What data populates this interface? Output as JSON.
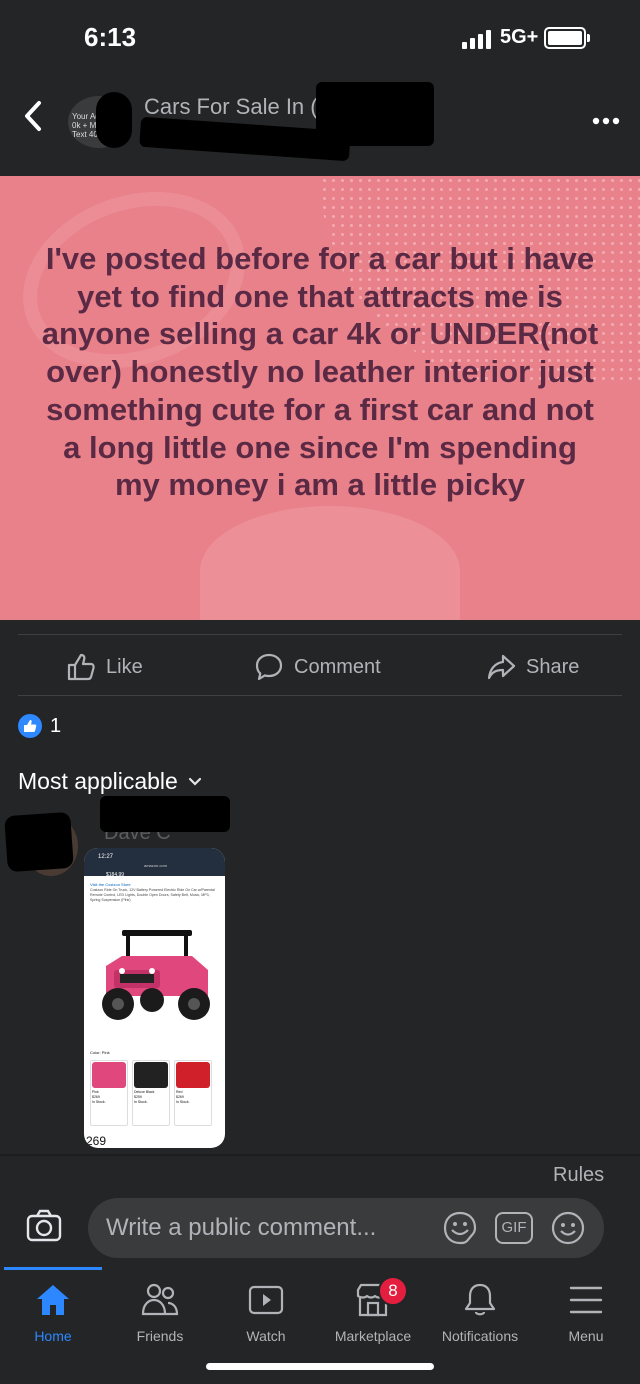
{
  "status_bar": {
    "time": "6:13",
    "network": "5G+"
  },
  "header": {
    "group_title": "Cars For Sale In (",
    "group_avatar_text": "Your Ad\n0k + M\nText 405",
    "back_icon": "chevron-left-icon",
    "more_icon": "more-dots-icon"
  },
  "post": {
    "background_color": "#e9818b",
    "text_color": "#5a2a45",
    "text": "I've posted before for a car but i have yet to find one that attracts me is anyone selling a car 4k or UNDER(not over) honestly no leather interior just something cute for a first car and not a long little one since I'm spending my money i am a little picky"
  },
  "actions": {
    "like": "Like",
    "comment": "Comment",
    "share": "Share"
  },
  "reactions": {
    "count": "1"
  },
  "comments_sort": {
    "label": "Most applicable"
  },
  "comment": {
    "author": "Dave C",
    "screenshot": {
      "time": "12:27",
      "url": "amazon.com",
      "price": "$184.99",
      "store": "Visit the Costzon Store",
      "description": "Costzon Ride On Truck, 12V Battery Powered Electric Ride On Car w/Parental Remote Control, LED Lights, Double Open Doors, Safety Belt, Music, MP3, Spring Suspension (Pink)",
      "color_label": "Color: Pink",
      "options": [
        {
          "name": "Pink",
          "price": "$269",
          "stock": "In Stock.",
          "color": "#e0487d"
        },
        {
          "name": "Deluxe Black",
          "price": "$259",
          "stock": "In Stock.",
          "color": "#222222"
        },
        {
          "name": "Red",
          "price": "$269",
          "stock": "In Stock.",
          "color": "#d0202a"
        }
      ],
      "bottom_price": "269"
    }
  },
  "composer": {
    "rules": "Rules",
    "placeholder": "Write a public comment...",
    "gif": "GIF"
  },
  "tabs": [
    {
      "label": "Home",
      "icon": "home-icon",
      "active": true
    },
    {
      "label": "Friends",
      "icon": "friends-icon"
    },
    {
      "label": "Watch",
      "icon": "watch-icon"
    },
    {
      "label": "Marketplace",
      "icon": "marketplace-icon",
      "badge": "8"
    },
    {
      "label": "Notifications",
      "icon": "bell-icon"
    },
    {
      "label": "Menu",
      "icon": "menu-icon"
    }
  ],
  "colors": {
    "accent": "#2d88ff",
    "background": "#242526",
    "badge": "#e41e3f"
  }
}
